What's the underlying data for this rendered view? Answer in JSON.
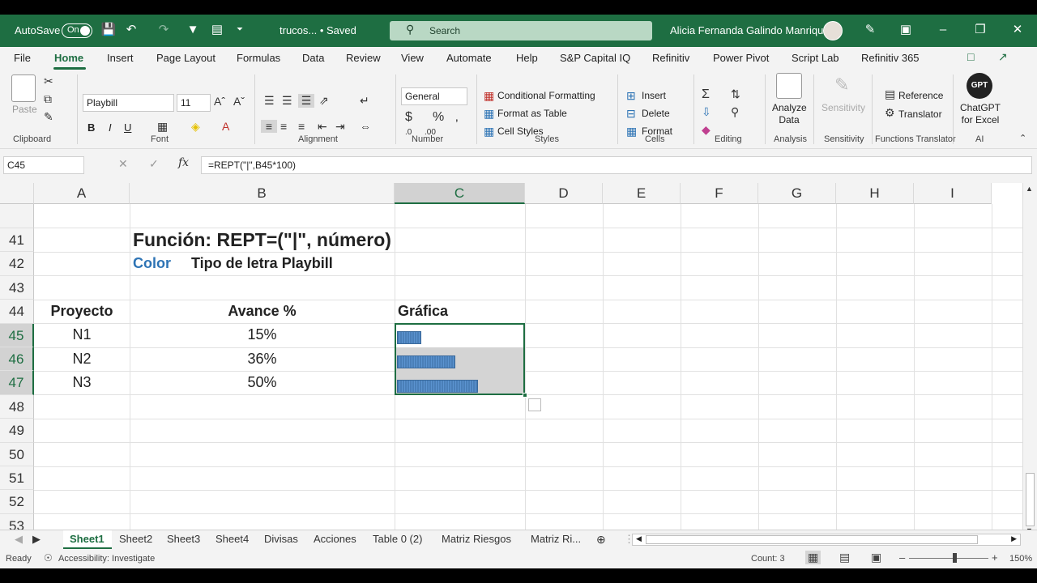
{
  "titlebar": {
    "autosave_label": "AutoSave",
    "autosave_state": "On",
    "filename": "trucos... • Saved",
    "search_placeholder": "Search",
    "user_name": "Alicia Fernanda Galindo Manrique"
  },
  "menu": [
    "File",
    "Home",
    "Insert",
    "Page Layout",
    "Formulas",
    "Data",
    "Review",
    "View",
    "Automate",
    "Help",
    "S&P Capital IQ",
    "Refinitiv",
    "Power Pivot",
    "Script Lab",
    "Refinitiv 365"
  ],
  "ribbon": {
    "clipboard": {
      "paste": "Paste",
      "label": "Clipboard"
    },
    "font": {
      "name": "Playbill",
      "size": "11",
      "label": "Font",
      "bold": "B",
      "italic": "I",
      "underline": "U"
    },
    "alignment": {
      "label": "Alignment"
    },
    "number": {
      "format": "General",
      "label": "Number"
    },
    "styles": {
      "conditional": "Conditional Formatting",
      "table": "Format as Table",
      "cell_styles": "Cell Styles",
      "label": "Styles"
    },
    "cells": {
      "insert": "Insert",
      "delete": "Delete",
      "format": "Format",
      "label": "Cells"
    },
    "editing": {
      "label": "Editing"
    },
    "analysis": {
      "analyze": "Analyze Data",
      "label": "Analysis"
    },
    "sensitivity": {
      "btn": "Sensitivity",
      "label": "Sensitivity"
    },
    "translator": {
      "reference": "Reference",
      "translator": "Translator",
      "label": "Functions Translator"
    },
    "ai": {
      "btn": "ChatGPT for Excel",
      "badge": "GPT",
      "label": "AI"
    }
  },
  "formula_bar": {
    "name_box": "C45",
    "formula": "=REPT(\"|\",B45*100)"
  },
  "columns": [
    "A",
    "B",
    "C",
    "D",
    "E",
    "F",
    "G",
    "H",
    "I"
  ],
  "rows": [
    "41",
    "42",
    "43",
    "44",
    "45",
    "46",
    "47",
    "48",
    "49",
    "50",
    "51",
    "52",
    "53"
  ],
  "cells": {
    "title": "Función: REPT=(\"|\", número)",
    "color_label": "Color",
    "font_label": "Tipo de letra  Playbill",
    "hdr_project": "Proyecto",
    "hdr_progress": "Avance %",
    "hdr_chart": "Gráfica",
    "data": [
      {
        "project": "N1",
        "progress": "15%",
        "fill": 0.15
      },
      {
        "project": "N2",
        "progress": "36%",
        "fill": 0.36
      },
      {
        "project": "N3",
        "progress": "50%",
        "fill": 0.5
      }
    ]
  },
  "sheets": [
    "Sheet1",
    "Sheet2",
    "Sheet3",
    "Sheet4",
    "Divisas",
    "Acciones",
    "Table 0 (2)",
    "Matriz Riesgos",
    "Matriz Ri..."
  ],
  "status": {
    "ready": "Ready",
    "accessibility": "Accessibility: Investigate",
    "count": "Count: 3",
    "zoom": "150%"
  },
  "colors": {
    "brand": "#1e6e42",
    "bar": "#4a7fb8",
    "link_blue": "#2e74b5"
  }
}
